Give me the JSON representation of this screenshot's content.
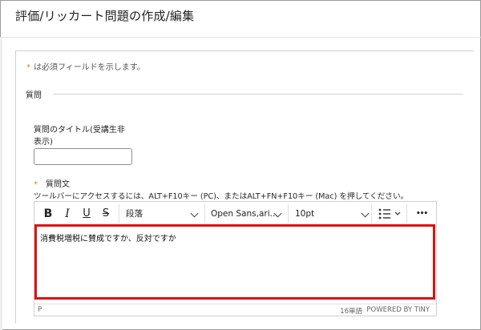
{
  "page": {
    "title": "評価/リッカート問題の作成/編集"
  },
  "form": {
    "required_star": "*",
    "required_note": "は必須フィールドを示します。",
    "section_legend": "質問",
    "title_label": "質問のタイトル(受講生非表示)",
    "title_value": "",
    "body_star": "*",
    "body_label": "質問文",
    "toolbar_hint": "ツールバーにアクセスするには、ALT+F10キー (PC)、またはALT+FN+F10キー (Mac) を押してください。"
  },
  "editor": {
    "toolbar": {
      "bold": "B",
      "italic": "I",
      "underline": "U",
      "strike": "S",
      "block_format": "段落",
      "font_family": "Open Sans,ari...",
      "font_size": "10pt",
      "more": "•••"
    },
    "content_text": "消費税増税に賛成ですか、反対ですか",
    "status_path": "P",
    "word_count": "16単語",
    "powered_by": "POWERED BY TINY"
  },
  "colors": {
    "highlight_border": "#e01010",
    "required_star": "#c98a1a"
  }
}
